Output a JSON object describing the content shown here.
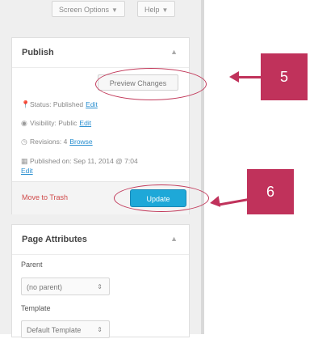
{
  "top_buttons": {
    "screen_options": "Screen Options",
    "help": "Help"
  },
  "publish": {
    "title": "Publish",
    "preview_changes": "Preview Changes",
    "status_label": "Status: Published",
    "status_edit": "Edit",
    "visibility_label": "Visibility: Public",
    "visibility_edit": "Edit",
    "revisions_label": "Revisions: 4",
    "revisions_browse": "Browse",
    "published_on": "Published on: Sep 11, 2014 @ 7:04",
    "published_edit": "Edit",
    "move_to_trash": "Move to Trash",
    "update": "Update"
  },
  "page_attributes": {
    "title": "Page Attributes",
    "parent_label": "Parent",
    "parent_value": "(no parent)",
    "template_label": "Template",
    "template_value": "Default Template"
  },
  "callouts": {
    "five": "5",
    "six": "6",
    "accent_color": "#c0325b"
  },
  "icons": {
    "status": "pin-icon",
    "visibility": "eye-icon",
    "revisions": "clock-icon",
    "published": "calendar-icon"
  }
}
